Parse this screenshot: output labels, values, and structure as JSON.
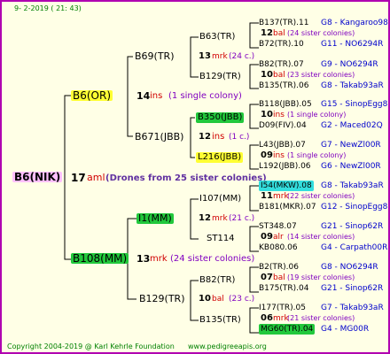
{
  "header": {
    "date": "9-  2-2019 ( 21: 43)"
  },
  "footer": {
    "copyright": "Copyright 2004-2019 @ Karl Kehrle Foundation",
    "site": "www.pedigreeapis.org"
  },
  "root": {
    "name": "B6(NIK)",
    "year": "17",
    "abbr": "aml",
    "note": "(Drones from 25 sister colonies)"
  },
  "gen1": {
    "upper": {
      "name": "B6(OR)",
      "year": "14",
      "abbr": "ins",
      "note": "(1 single colony)"
    },
    "lower": {
      "name": "B108(MM)",
      "year": "13",
      "abbr": "mrk",
      "note": "(24 sister colonies)"
    }
  },
  "gen2": {
    "a": {
      "name": "B69(TR)",
      "year": "13",
      "abbr": "mrk",
      "note": "(24 c.)"
    },
    "b": {
      "name": "B671(JBB)",
      "year": "12",
      "abbr": "ins",
      "note": "(1 c.)"
    },
    "c": {
      "name": "I1(MM)",
      "year": "12",
      "abbr": "mrk",
      "note": "(21 c.)"
    },
    "d": {
      "name": "B129(TR)",
      "year": "10",
      "abbr": "bal",
      "note": "(23 c.)"
    }
  },
  "gen3": {
    "a1": "B63(TR)",
    "a2": "B129(TR)",
    "b1": "B350(JBB)",
    "b2": "L216(JBB)",
    "c1": "I107(MM)",
    "c2": "ST114",
    "d1": "B82(TR)",
    "d2": "B135(TR)"
  },
  "gen4": [
    {
      "upper": "B137(TR).11",
      "uc": "G8 - Kangaroo98R",
      "year": "12",
      "abbr": "bal",
      "note": "(24 sister colonies)",
      "lower": "B72(TR).10",
      "lc": "G11 - NO6294R"
    },
    {
      "upper": "B82(TR).07",
      "uc": "G9 - NO6294R",
      "year": "10",
      "abbr": "bal",
      "note": "(23 sister colonies)",
      "lower": "B135(TR).06",
      "lc": "G8 - Takab93aR"
    },
    {
      "upper": "B118(JBB).05",
      "uc": "G15 - SinopEgg86R",
      "year": "10",
      "abbr": "ins",
      "note": "(1 single colony)",
      "lower": "D09(FIV).04",
      "lc": "G2 - Maced02Q"
    },
    {
      "upper": "L43(JBB).07",
      "uc": "G7 - NewZl00R",
      "year": "09",
      "abbr": "ins",
      "note": "(1 single colony)",
      "lower": "L192(JBB).06",
      "lc": "G6 - NewZl00R"
    },
    {
      "upper": "I54(MKW).08",
      "uc": "G8 - Takab93aR",
      "year": "11",
      "abbr": "mrk",
      "note": "(22 sister colonies)",
      "lower": "B181(MKR).07",
      "lc": "G12 - SinopEgg86R"
    },
    {
      "upper": "ST348.07",
      "uc": "G21 - Sinop62R",
      "year": "09",
      "abbr": "alr",
      "note": "(14 sister colonies)",
      "lower": "KB080.06",
      "lc": "G4 - Carpath00R"
    },
    {
      "upper": "B2(TR).06",
      "uc": "G8 - NO6294R",
      "year": "07",
      "abbr": "bal",
      "note": "(19 sister colonies)",
      "lower": "B175(TR).04",
      "lc": "G21 - Sinop62R"
    },
    {
      "upper": "I177(TR).05",
      "uc": "G7 - Takab93aR",
      "year": "06",
      "abbr": "mrk",
      "note": "(21 sister colonies)",
      "lower": "MG60(TR).04",
      "lc": "G4 - MG00R"
    }
  ]
}
